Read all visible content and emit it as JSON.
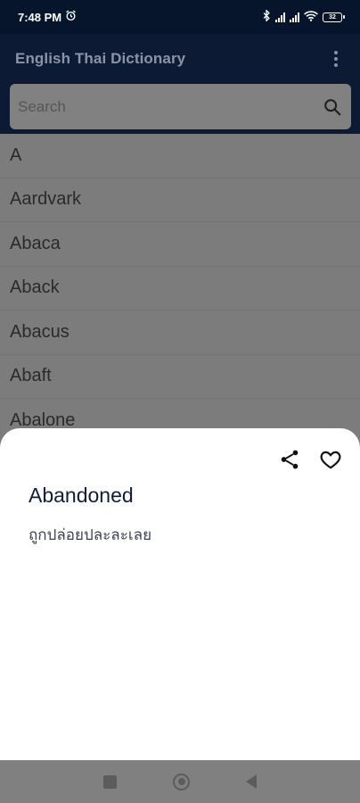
{
  "status_bar": {
    "time": "7:48 PM",
    "battery": "32"
  },
  "app_bar": {
    "title": "English Thai Dictionary"
  },
  "search": {
    "placeholder": "Search"
  },
  "word_list": [
    "A",
    "Aardvark",
    "Abaca",
    "Aback",
    "Abacus",
    "Abaft",
    "Abalone"
  ],
  "sheet": {
    "word": "Abandoned",
    "translation": "ถูกปล่อยปละละเลย"
  },
  "colors": {
    "header_bg": "#0d1a33",
    "status_bg": "#06152b",
    "scrim": "#7c7c7c",
    "sheet_bg": "#ffffff",
    "word_color": "#131c3a"
  }
}
